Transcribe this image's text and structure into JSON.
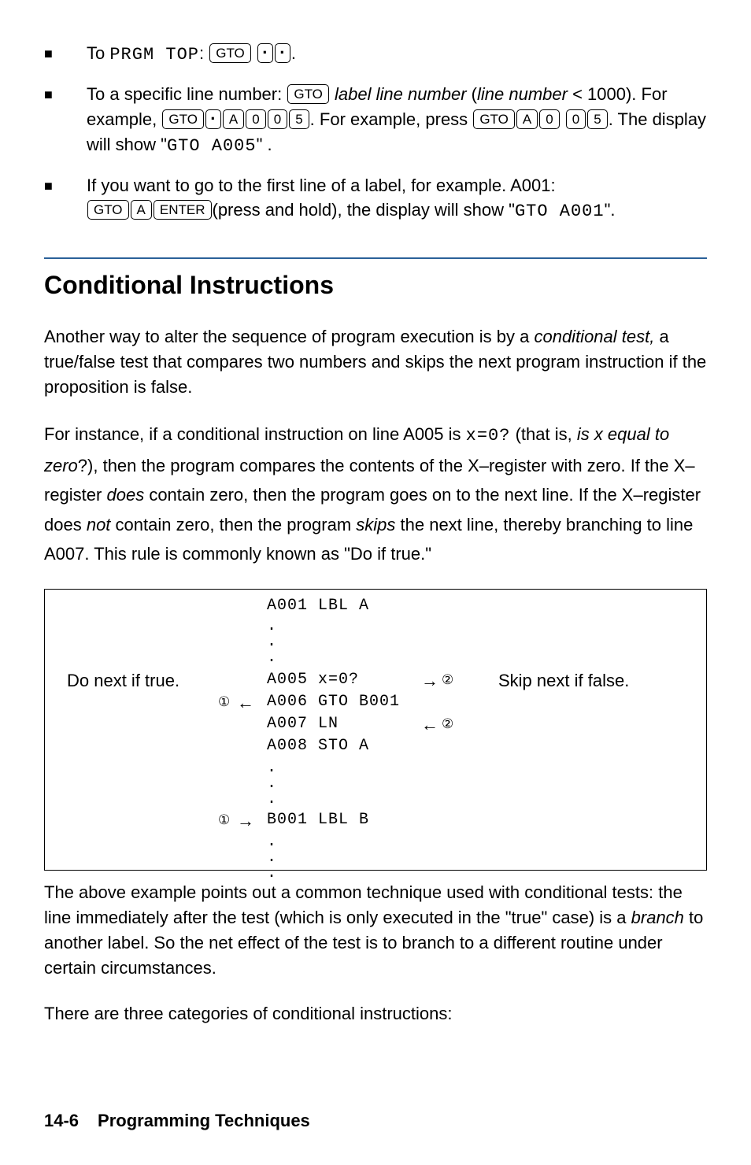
{
  "bullets": {
    "b1": {
      "prefix": "To ",
      "seg1": "PRGM TOP",
      "colon": ":  ",
      "key_gto": "GTO",
      "period": "."
    },
    "b2": {
      "t1": "To a specific line number:  ",
      "key_gto": "GTO",
      "t2": "  ",
      "ital1": "label line number",
      "t3": " (",
      "ital2": "line number",
      "t4": " < 1000). For example, ",
      "k_a": "A",
      "k_0": "0",
      "k_5": "5",
      "t5": ". For example, press ",
      "t6": ". The display will show \"",
      "seg1": "GTO A005",
      "t7": "\" ."
    },
    "b3": {
      "t1": "If you want to go to the first line of a label, for example. A001: ",
      "k_gto": "GTO",
      "k_a": "A",
      "k_enter": "ENTER",
      "t2": "(press and hold), the display will show \"",
      "seg1": "GTO A001",
      "t3": "\"."
    }
  },
  "heading": "Conditional Instructions",
  "para1": {
    "t1": "Another way to alter the sequence of program execution is by a ",
    "ital1": "conditional test,",
    "t2": " a true/false test that compares two numbers and skips the next program instruction if the proposition is false."
  },
  "para2": {
    "t1": "For instance, if a conditional instruction on line A005 is ",
    "seg1": "x=0?",
    "t2": " (that is, ",
    "ital1": "is x equal to zero",
    "t3": "?), then the program compares the contents of the X–register with zero. If the X–register ",
    "ital2": "does",
    "t4": " contain zero, then the program goes on to the next line. If the X–register does ",
    "ital3": "not",
    "t5": " contain zero, then the program ",
    "ital4": "skips",
    "t6": " the next line, thereby branching to line A007. This rule is commonly known as \"Do if true.\""
  },
  "code": {
    "l1": "A001 LBL A",
    "l2": ".",
    "l3": ".",
    "l4": ".",
    "l5": "A005 x=0?",
    "l6": "A006 GTO B001",
    "l7": "A007 LN",
    "l8": "A008 STO A",
    "l9": ".",
    "l10": ".",
    "l11": ".",
    "l12": "B001 LBL B",
    "l13": ".",
    "l14": ".",
    "l15": "."
  },
  "anno": {
    "left": "Do next if true.",
    "right": "Skip next if false.",
    "one_left_a": "①",
    "one_left_b": "①",
    "two_right_a": "②",
    "two_right_b": "②",
    "arr_l": "←",
    "arr_r": "→"
  },
  "para3": {
    "t1": "The above example points out a common technique used with conditional tests: the line immediately after the test (which is only executed in the \"true\" case) is a ",
    "ital1": "branch",
    "t2": " to another label. So the net effect of the test is to branch to a different routine under certain circumstances."
  },
  "para4": "There are three categories of conditional instructions:",
  "footer": {
    "page": "14-6",
    "title": "Programming Techniques"
  }
}
